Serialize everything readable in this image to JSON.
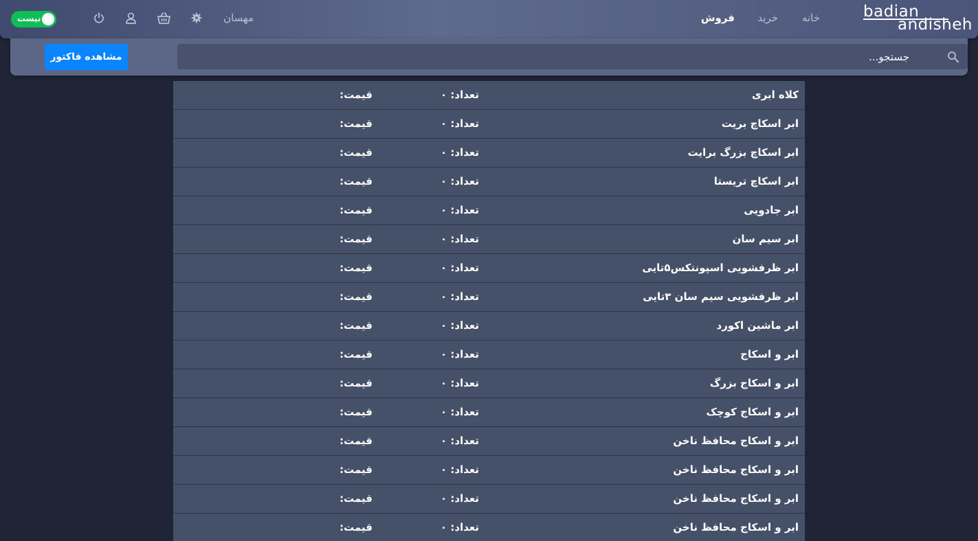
{
  "header": {
    "logo_line1": "badian",
    "logo_line2": "andisheh",
    "nav": {
      "home": "خانه",
      "buy": "خرید",
      "sell": "فروش"
    },
    "guest_label": "مهسان",
    "toggle_label": "نیست",
    "icons": [
      "gear-icon",
      "basket-icon",
      "user-icon",
      "power-icon"
    ],
    "accent_green": "#0fbf55"
  },
  "search": {
    "placeholder": "جستجو...",
    "invoice_button": "مشاهده فاکتور",
    "button_color": "#0a84ff"
  },
  "products": [
    {
      "name": "کلاه ابری",
      "qty_label": "تعداد: ۰",
      "price_label": "قیمت:"
    },
    {
      "name": "ابر اسکاچ بریت",
      "qty_label": "تعداد: ۰",
      "price_label": "قیمت:"
    },
    {
      "name": "ابر اسکاچ بزرگ برایت",
      "qty_label": "تعداد: ۰",
      "price_label": "قیمت:"
    },
    {
      "name": "ابر اسکاچ تریستا",
      "qty_label": "تعداد: ۰",
      "price_label": "قیمت:"
    },
    {
      "name": "ابر جادویی",
      "qty_label": "تعداد: ۰",
      "price_label": "قیمت:"
    },
    {
      "name": "ابر سیم سان",
      "qty_label": "تعداد: ۰",
      "price_label": "قیمت:"
    },
    {
      "name": "ابر ظرفشویی اسپونتکس۵تایی",
      "qty_label": "تعداد: ۰",
      "price_label": "قیمت:"
    },
    {
      "name": "ابر ظرفشویی سیم سان ۳تایی",
      "qty_label": "تعداد: ۰",
      "price_label": "قیمت:"
    },
    {
      "name": "ابر ماشین اکورد",
      "qty_label": "تعداد: ۰",
      "price_label": "قیمت:"
    },
    {
      "name": "ابر و اسکاج",
      "qty_label": "تعداد: ۰",
      "price_label": "قیمت:"
    },
    {
      "name": "ابر و اسکاج بزرگ",
      "qty_label": "تعداد: ۰",
      "price_label": "قیمت:"
    },
    {
      "name": "ابر و اسکاج کوچک",
      "qty_label": "تعداد: ۰",
      "price_label": "قیمت:"
    },
    {
      "name": "ابر و اسکاج محافظ ناخن",
      "qty_label": "تعداد: ۰",
      "price_label": "قیمت:"
    },
    {
      "name": "ابر و اسکاج محافظ ناخن",
      "qty_label": "تعداد: ۰",
      "price_label": "قیمت:"
    },
    {
      "name": "ابر و اسکاج محافظ ناخن",
      "qty_label": "تعداد: ۰",
      "price_label": "قیمت:"
    },
    {
      "name": "ابر و اسکاج محافظ ناخن",
      "qty_label": "تعداد: ۰",
      "price_label": "قیمت:"
    }
  ]
}
